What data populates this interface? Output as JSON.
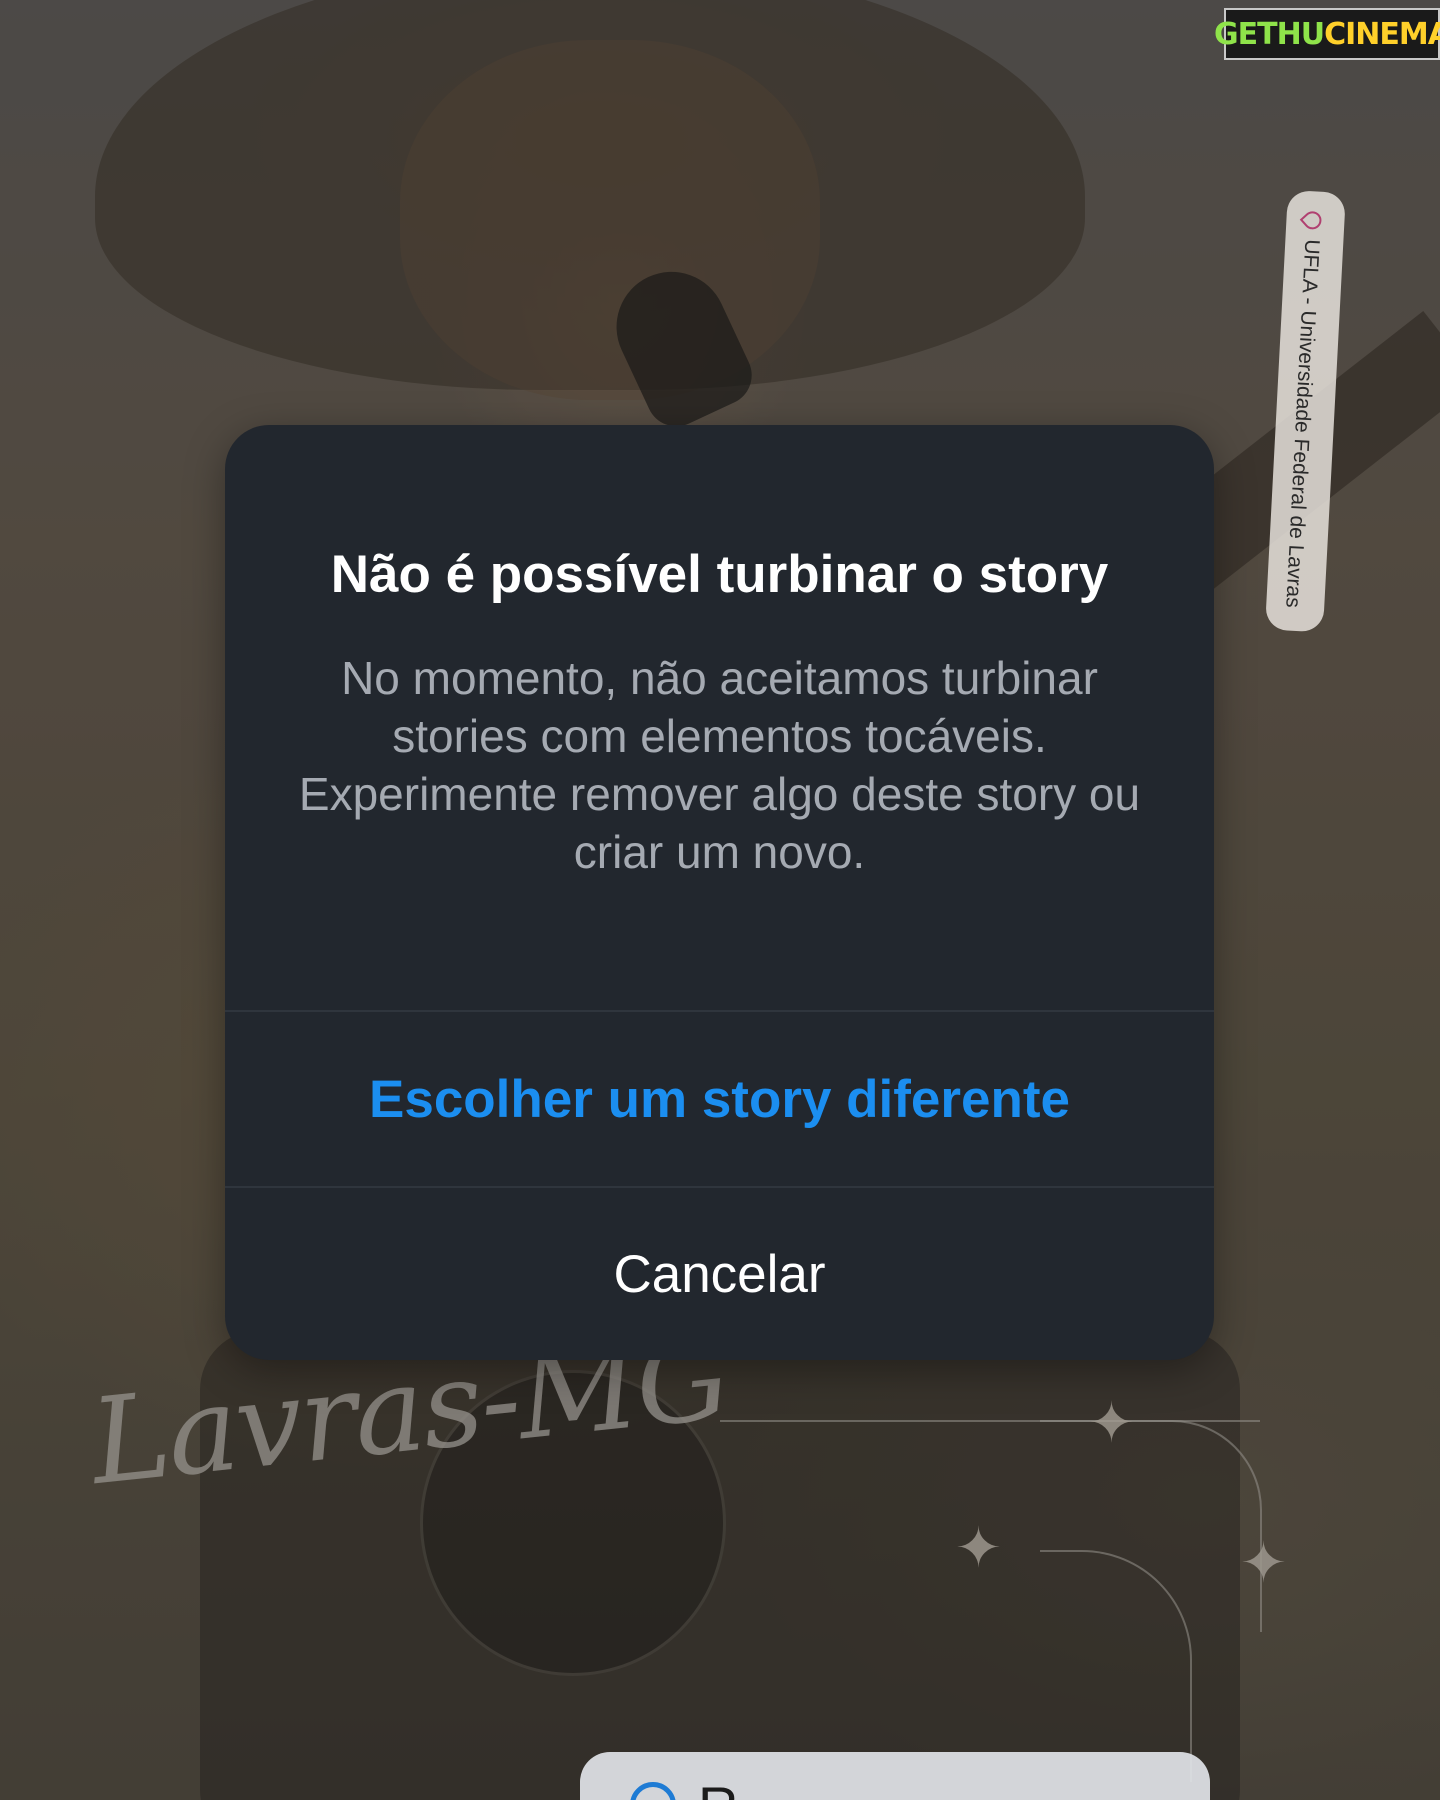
{
  "watermark": {
    "part1": "GETHU",
    "part2": "CINEMA"
  },
  "location_sticker": {
    "icon": "location-pin-icon",
    "text": "UFLA - Universidade Federal de Lavras"
  },
  "story_overlay": {
    "script_text": "Lavras-MG",
    "bottom_pill_text": "R"
  },
  "dialog": {
    "title": "Não é possível turbinar o story",
    "message": "No momento, não aceitamos turbinar stories com elementos tocáveis. Experimente remover algo deste story ou criar um novo.",
    "primary_action": "Escolher um story diferente",
    "cancel_action": "Cancelar"
  },
  "colors": {
    "dialog_bg": "#22272e",
    "primary_action": "#1b8ef0",
    "title": "#ffffff",
    "message": "#a5aab2"
  }
}
